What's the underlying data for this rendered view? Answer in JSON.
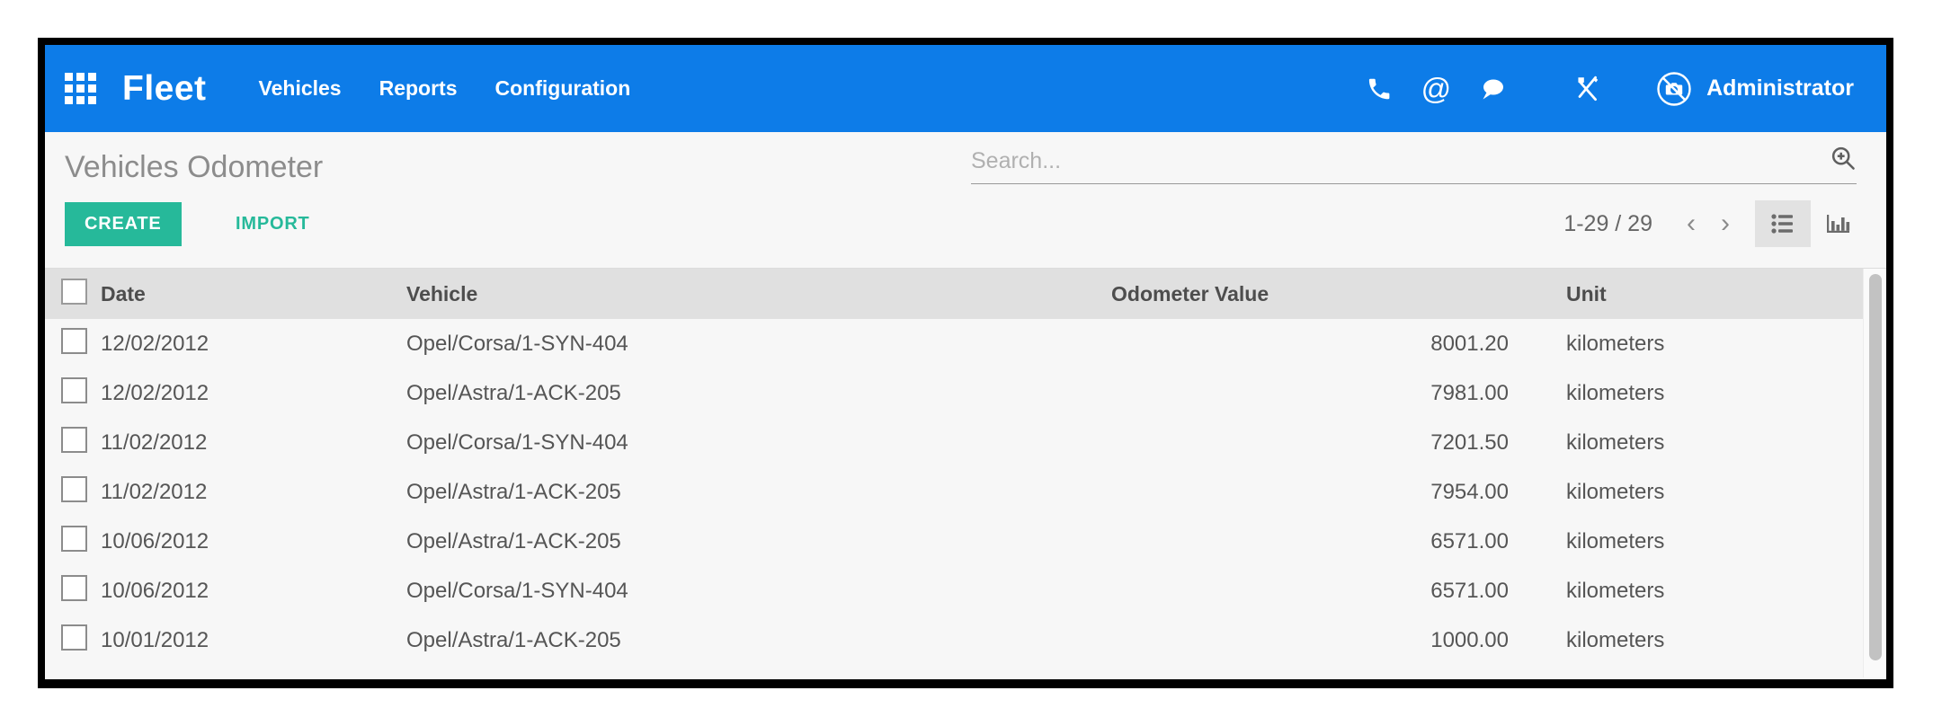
{
  "topbar": {
    "apps_icon": "apps-grid-icon",
    "brand": "Fleet",
    "menu": [
      {
        "label": "Vehicles"
      },
      {
        "label": "Reports"
      },
      {
        "label": "Configuration"
      }
    ],
    "icons": [
      {
        "name": "phone-icon"
      },
      {
        "name": "at-icon",
        "glyph": "@"
      },
      {
        "name": "chat-bubble-icon"
      },
      {
        "name": "tools-icon"
      },
      {
        "name": "no-camera-avatar-icon"
      }
    ],
    "user": "Administrator",
    "background_color": "#0d7ce8"
  },
  "control": {
    "page_title": "Vehicles Odometer",
    "create_label": "CREATE",
    "import_label": "IMPORT",
    "create_color": "#26b99a",
    "search": {
      "placeholder": "Search...",
      "value": "",
      "icon": "search-plus-icon"
    },
    "pager": {
      "count": "1-29 / 29",
      "prev": "‹",
      "next": "›"
    },
    "views": [
      {
        "name": "list-view",
        "active": true
      },
      {
        "name": "chart-view",
        "active": false
      }
    ]
  },
  "table": {
    "columns": [
      "Date",
      "Vehicle",
      "Odometer Value",
      "Unit"
    ],
    "rows": [
      {
        "date": "12/02/2012",
        "vehicle": "Opel/Corsa/1-SYN-404",
        "odometer": "8001.20",
        "unit": "kilometers"
      },
      {
        "date": "12/02/2012",
        "vehicle": "Opel/Astra/1-ACK-205",
        "odometer": "7981.00",
        "unit": "kilometers"
      },
      {
        "date": "11/02/2012",
        "vehicle": "Opel/Corsa/1-SYN-404",
        "odometer": "7201.50",
        "unit": "kilometers"
      },
      {
        "date": "11/02/2012",
        "vehicle": "Opel/Astra/1-ACK-205",
        "odometer": "7954.00",
        "unit": "kilometers"
      },
      {
        "date": "10/06/2012",
        "vehicle": "Opel/Astra/1-ACK-205",
        "odometer": "6571.00",
        "unit": "kilometers"
      },
      {
        "date": "10/06/2012",
        "vehicle": "Opel/Corsa/1-SYN-404",
        "odometer": "6571.00",
        "unit": "kilometers"
      },
      {
        "date": "10/01/2012",
        "vehicle": "Opel/Astra/1-ACK-205",
        "odometer": "1000.00",
        "unit": "kilometers"
      }
    ]
  }
}
